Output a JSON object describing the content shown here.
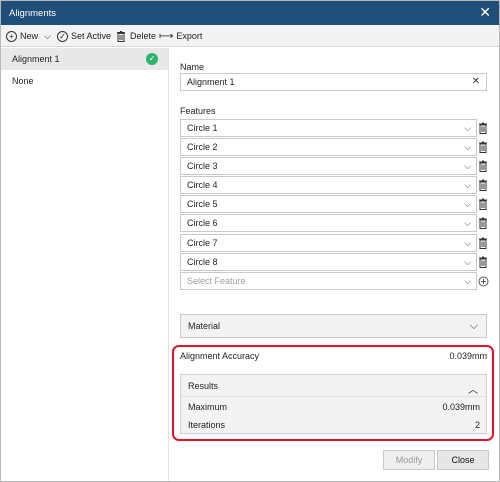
{
  "window": {
    "title": "Alignments",
    "close_glyph": "✕"
  },
  "toolbar": {
    "new_label": "New",
    "set_active_label": "Set Active",
    "delete_label": "Delete",
    "export_label": "Export"
  },
  "sidebar": {
    "items": [
      {
        "label": "Alignment 1",
        "active": true
      },
      {
        "label": "None"
      }
    ]
  },
  "form": {
    "name_label": "Name",
    "name_value": "Alignment 1",
    "features_label": "Features",
    "features": [
      "Circle 1",
      "Circle 2",
      "Circle 3",
      "Circle 4",
      "Circle 5",
      "Circle 6",
      "Circle 7",
      "Circle 8"
    ],
    "feature_placeholder": "Select Feature",
    "material_label": "Material"
  },
  "accuracy": {
    "label": "Alignment Accuracy",
    "value": "0.039mm",
    "highlight_color": "#e0142a"
  },
  "results": {
    "header": "Results",
    "rows": [
      {
        "label": "Maximum",
        "value": "0.039mm"
      },
      {
        "label": "Iterations",
        "value": "2"
      }
    ]
  },
  "footer": {
    "modify_label": "Modify",
    "close_label": "Close"
  },
  "colors": {
    "titlebar": "#1f4e79",
    "active_check": "#2fb56b"
  }
}
